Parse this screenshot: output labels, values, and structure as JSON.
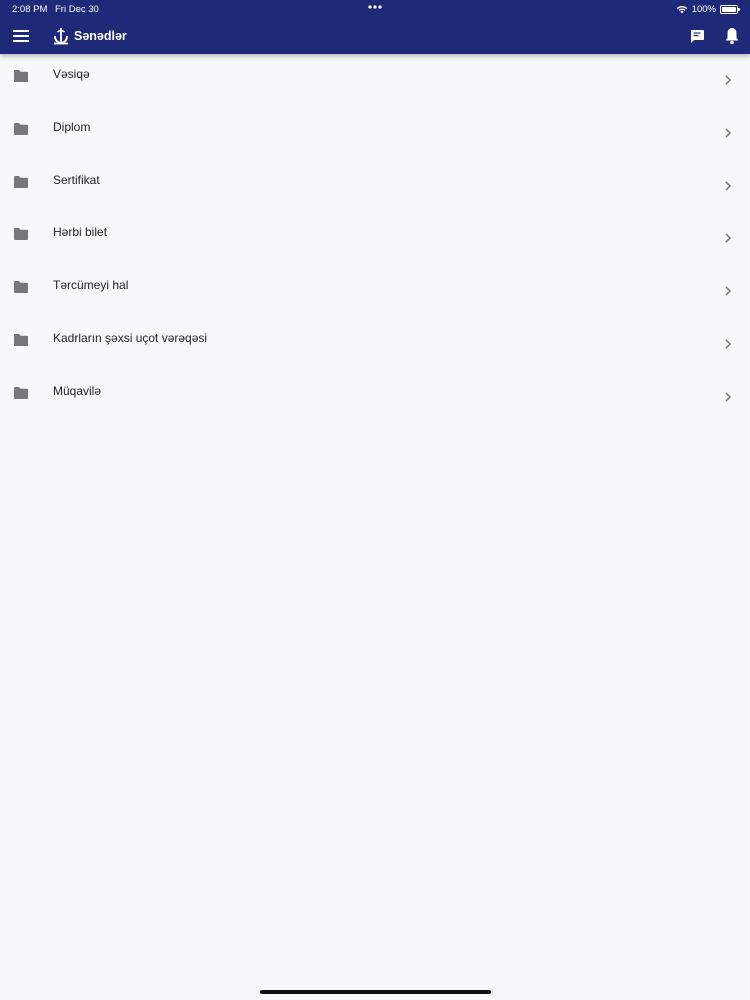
{
  "status_bar": {
    "time": "2:08 PM",
    "date": "Fri Dec 30",
    "battery": "100%",
    "wifi_icon": "wifi-icon",
    "battery_level": 1.0
  },
  "app_bar": {
    "title": "Sənədlər",
    "background_color": "#1e2a78",
    "menu_icon": "hamburger-menu-icon",
    "logo_icon": "anchor-logo-icon",
    "chat_icon": "chat-icon",
    "notifications_icon": "bell-icon"
  },
  "documents": [
    {
      "label": "Vəsiqə"
    },
    {
      "label": "Diplom"
    },
    {
      "label": "Sertifikat"
    },
    {
      "label": "Hərbi bilet"
    },
    {
      "label": "Tərcümeyi hal"
    },
    {
      "label": "Kadrların şəxsi uçot vərəqəsi"
    },
    {
      "label": "Müqavilə"
    }
  ],
  "icons": {
    "row_leading": "folder-icon",
    "row_trailing": "chevron-right-icon"
  },
  "colors": {
    "folder": "#777777",
    "chevron": "#777777",
    "background": "#f8f8fb"
  }
}
